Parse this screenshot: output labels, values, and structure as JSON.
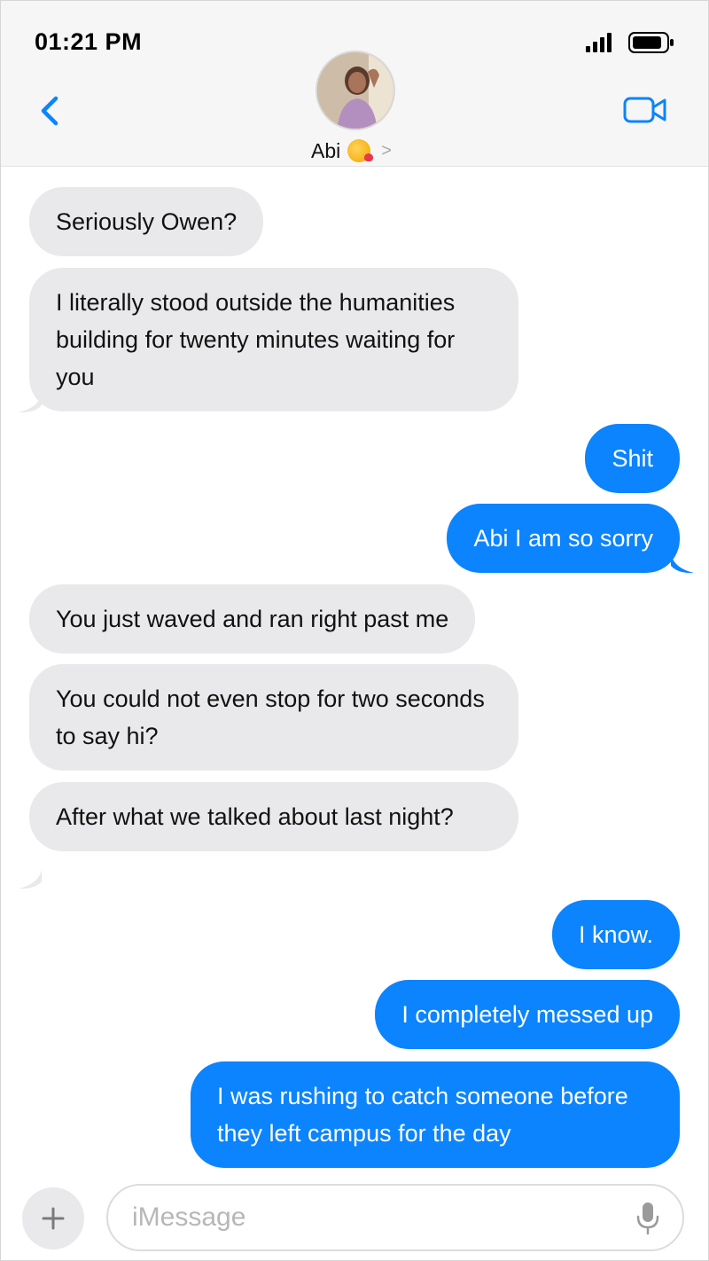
{
  "status_bar": {
    "time": "01:21 PM"
  },
  "header": {
    "contact_name": "Abi",
    "contact_emoji": "kissing-face-emoji",
    "back_icon": "chevron-left-icon",
    "video_icon": "video-camera-icon"
  },
  "messages": [
    {
      "from": "received",
      "text": "Seriously Owen?"
    },
    {
      "from": "received",
      "text": "I literally stood outside the humanities building for twenty minutes waiting for you"
    },
    {
      "from": "sent",
      "text": "Shit"
    },
    {
      "from": "sent",
      "text": "Abi I am so sorry"
    },
    {
      "from": "received",
      "text": "You just waved and ran right past me"
    },
    {
      "from": "received",
      "text": "You could not even stop for two seconds to say hi?"
    },
    {
      "from": "received",
      "text": "After what we talked about last night?"
    },
    {
      "from": "sent",
      "text": "I know."
    },
    {
      "from": "sent",
      "text": "I completely messed up"
    },
    {
      "from": "sent",
      "text": "I was rushing to catch someone before they left campus for the day"
    }
  ],
  "composer": {
    "placeholder": "iMessage"
  },
  "colors": {
    "sent_bubble": "#0b84fe",
    "received_bubble": "#e9e9eb",
    "accent": "#0b84fe"
  }
}
